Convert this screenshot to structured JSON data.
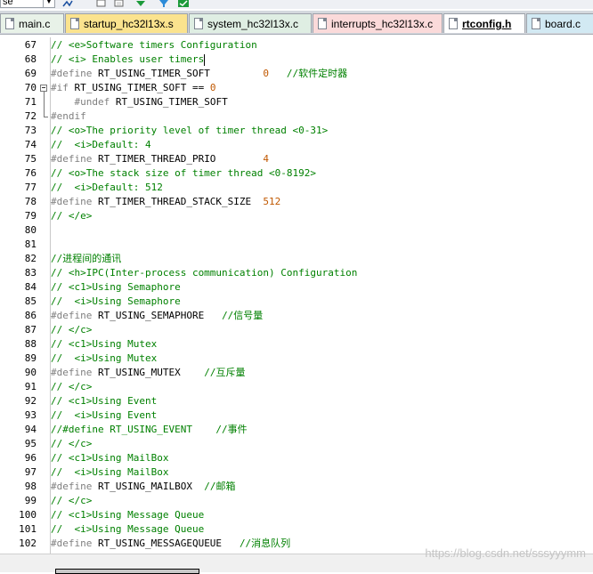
{
  "toolbar": {
    "dropdown_value": "se",
    "icons": [
      "find-in-files-icon",
      "new-window-icon",
      "copy-icon",
      "download-green-icon",
      "filter-icon",
      "check-icon"
    ]
  },
  "tabs": [
    {
      "label": "main.c",
      "color": "#e8f2e8",
      "active": false
    },
    {
      "label": "startup_hc32l13x.s",
      "color": "#fbe38e",
      "active": false
    },
    {
      "label": "system_hc32l13x.c",
      "color": "#dfeee3",
      "active": false
    },
    {
      "label": "interrupts_hc32l13x.c",
      "color": "#fbdada",
      "active": false
    },
    {
      "label": "rtconfig.h",
      "color": "#ffffff",
      "active": true
    },
    {
      "label": "board.c",
      "color": "#d2e9f3",
      "active": false
    }
  ],
  "lines": [
    {
      "n": "67",
      "kind": "comment",
      "text": "// <e>Software timers Configuration"
    },
    {
      "n": "68",
      "kind": "comment",
      "text": "// <i> Enables user timers",
      "caret": true
    },
    {
      "n": "69",
      "kind": "define",
      "pre": "#define",
      "ident": " RT_USING_TIMER_SOFT         ",
      "val": "0",
      "cm": "   //软件定时器"
    },
    {
      "n": "70",
      "kind": "define",
      "pre": "#if",
      "ident": " RT_USING_TIMER_SOFT == ",
      "val": "0",
      "cm": "",
      "fold": "open"
    },
    {
      "n": "71",
      "kind": "define",
      "pre": "    #undef",
      "ident": " RT_USING_TIMER_SOFT",
      "val": "",
      "cm": ""
    },
    {
      "n": "72",
      "kind": "pponly",
      "pre": "#endif",
      "foldend": true
    },
    {
      "n": "73",
      "kind": "comment",
      "text": "// <o>The priority level of timer thread <0-31>"
    },
    {
      "n": "74",
      "kind": "comment",
      "text": "//  <i>Default: 4"
    },
    {
      "n": "75",
      "kind": "define",
      "pre": "#define",
      "ident": " RT_TIMER_THREAD_PRIO        ",
      "val": "4",
      "cm": ""
    },
    {
      "n": "76",
      "kind": "comment",
      "text": "// <o>The stack size of timer thread <0-8192>"
    },
    {
      "n": "77",
      "kind": "comment",
      "text": "//  <i>Default: 512"
    },
    {
      "n": "78",
      "kind": "define",
      "pre": "#define",
      "ident": " RT_TIMER_THREAD_STACK_SIZE  ",
      "val": "512",
      "cm": ""
    },
    {
      "n": "79",
      "kind": "comment",
      "text": "// </e>"
    },
    {
      "n": "80",
      "kind": "blank",
      "text": ""
    },
    {
      "n": "81",
      "kind": "blank",
      "text": ""
    },
    {
      "n": "82",
      "kind": "comment",
      "text": "//进程间的通讯"
    },
    {
      "n": "83",
      "kind": "comment",
      "text": "// <h>IPC(Inter-process communication) Configuration"
    },
    {
      "n": "84",
      "kind": "comment",
      "text": "// <c1>Using Semaphore"
    },
    {
      "n": "85",
      "kind": "comment",
      "text": "//  <i>Using Semaphore"
    },
    {
      "n": "86",
      "kind": "define",
      "pre": "#define",
      "ident": " RT_USING_SEMAPHORE   ",
      "val": "",
      "cm": "//信号量"
    },
    {
      "n": "87",
      "kind": "comment",
      "text": "// </c>"
    },
    {
      "n": "88",
      "kind": "comment",
      "text": "// <c1>Using Mutex"
    },
    {
      "n": "89",
      "kind": "comment",
      "text": "//  <i>Using Mutex"
    },
    {
      "n": "90",
      "kind": "define",
      "pre": "#define",
      "ident": " RT_USING_MUTEX    ",
      "val": "",
      "cm": "//互斥量"
    },
    {
      "n": "91",
      "kind": "comment",
      "text": "// </c>"
    },
    {
      "n": "92",
      "kind": "comment",
      "text": "// <c1>Using Event"
    },
    {
      "n": "93",
      "kind": "comment",
      "text": "//  <i>Using Event"
    },
    {
      "n": "94",
      "kind": "comment",
      "text": "//#define RT_USING_EVENT    //事件"
    },
    {
      "n": "95",
      "kind": "comment",
      "text": "// </c>"
    },
    {
      "n": "96",
      "kind": "comment",
      "text": "// <c1>Using MailBox"
    },
    {
      "n": "97",
      "kind": "comment",
      "text": "//  <i>Using MailBox"
    },
    {
      "n": "98",
      "kind": "define",
      "pre": "#define",
      "ident": " RT_USING_MAILBOX  ",
      "val": "",
      "cm": "//邮箱"
    },
    {
      "n": "99",
      "kind": "comment",
      "text": "// </c>"
    },
    {
      "n": "100",
      "kind": "comment",
      "text": "// <c1>Using Message Queue"
    },
    {
      "n": "101",
      "kind": "comment",
      "text": "//  <i>Using Message Queue"
    },
    {
      "n": "102",
      "kind": "define",
      "pre": "#define",
      "ident": " RT_USING_MESSAGEQUEUE   ",
      "val": "",
      "cm": "//消息队列"
    }
  ],
  "watermark": "https://blog.csdn.net/sssyyymm"
}
